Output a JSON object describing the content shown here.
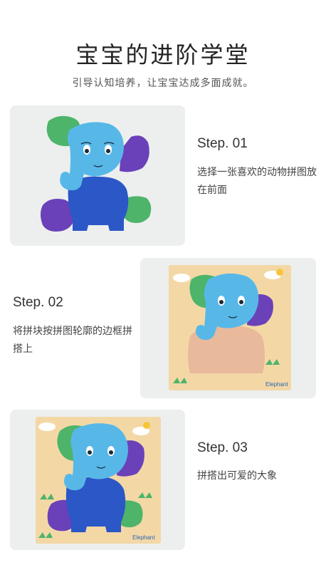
{
  "header": {
    "title": "宝宝的进阶学堂",
    "subtitle": "引导认知培养，让宝宝达成多面成就。"
  },
  "steps": [
    {
      "label": "Step. 01",
      "description": "选择一张喜欢的动物拼图放在前面"
    },
    {
      "label": "Step. 02",
      "description": "将拼块按拼图轮廓的边框拼搭上"
    },
    {
      "label": "Step. 03",
      "description": "拼搭出可爱的大象"
    }
  ],
  "board": {
    "label": "Elephant"
  },
  "colors": {
    "card_bg": "#ecefee",
    "elephant_blue": "#57b8e8",
    "body_blue": "#2c57c6",
    "ear_purple": "#6a41b8",
    "green": "#52b86a",
    "wood": "#f3d8a6"
  }
}
